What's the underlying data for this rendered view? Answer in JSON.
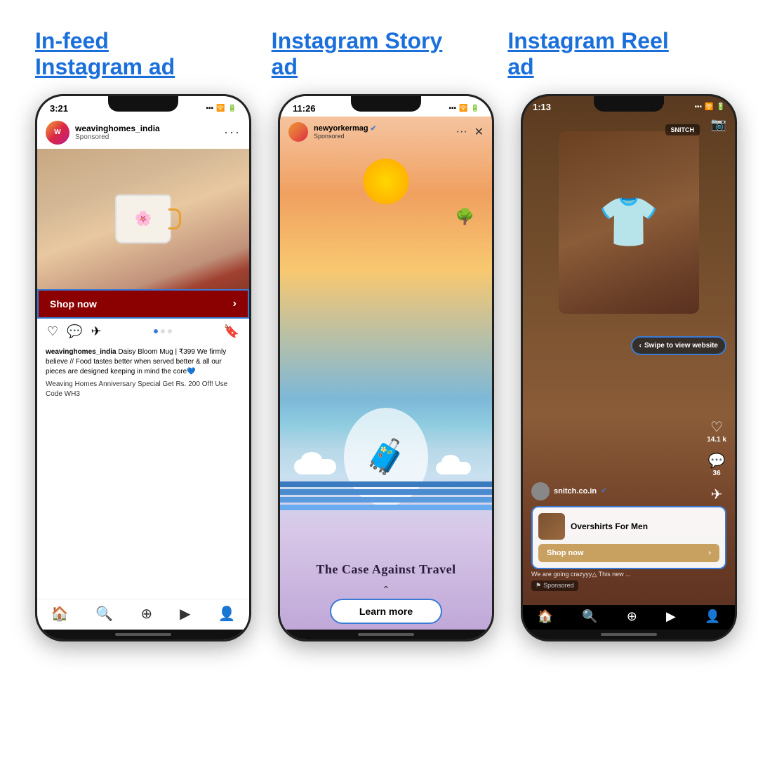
{
  "labels": {
    "feed": "In-feed\nInstagram ad",
    "story": "Instagram Story\nad",
    "reel": "Instagram Reel\nad"
  },
  "phone1": {
    "time": "3:21",
    "username": "weavinghomes_india",
    "sponsored": "Sponsored",
    "shop_btn": "Shop now",
    "caption_user": "weavinghomes_india",
    "caption_text": " Daisy Bloom Mug | ₹399 We firmly believe // Food tastes better when served better & all our pieces are designed keeping in mind the core💙",
    "caption_extra": "Weaving Homes Anniversary Special Get Rs. 200 Off! Use Code WH3"
  },
  "phone2": {
    "time": "11:26",
    "username": "newyorkermag",
    "sponsored": "Sponsored",
    "title": "The Case Against Travel",
    "learn_more": "Learn more"
  },
  "phone3": {
    "time": "1:13",
    "username": "snitch.co.in",
    "swipe_label": "Swipe to view website",
    "product_name": "Overshirts For Men",
    "shop_btn": "Shop now",
    "caption": "We are going crazyyy△ This new ...",
    "sponsored": "Sponsored",
    "likes": "14.1 k",
    "comments": "36",
    "brand_label": "SNITCH"
  }
}
